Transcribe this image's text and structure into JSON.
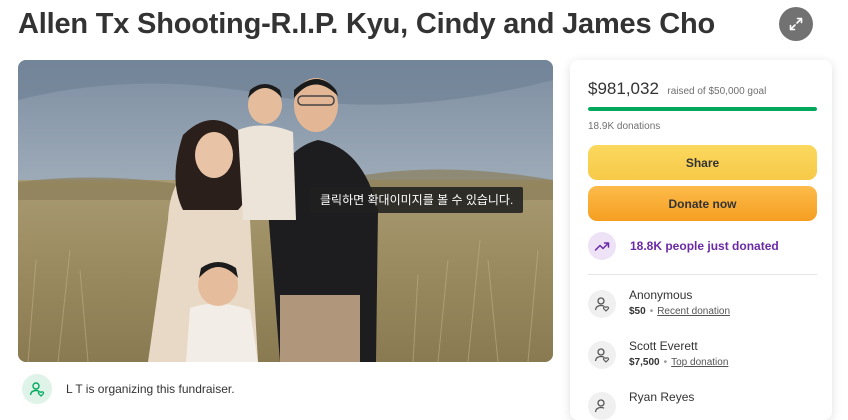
{
  "page": {
    "title": "Allen Tx Shooting-R.I.P. Kyu, Cindy and James Cho"
  },
  "hero": {
    "tooltip": "클릭하면 확대이미지를 볼 수 있습니다."
  },
  "organizer": {
    "text": "L T is organizing this fundraiser."
  },
  "donation_card": {
    "raised_amount": "$981,032",
    "goal_text": "raised of $50,000 goal",
    "progress_fraction": 1.0,
    "donation_count": "18.9K donations",
    "share_label": "Share",
    "donate_label": "Donate now",
    "recent_activity": "18.8K people just donated",
    "donors": [
      {
        "name": "Anonymous",
        "amount": "$50",
        "tag": "Recent donation"
      },
      {
        "name": "Scott Everett",
        "amount": "$7,500",
        "tag": "Top donation"
      },
      {
        "name": "Ryan Reyes",
        "amount": "",
        "tag": ""
      }
    ]
  },
  "colors": {
    "progress_green": "#02a95c",
    "share_yellow": "#f7c948",
    "donate_orange": "#f59f22",
    "trend_purple": "#6b2aa5"
  },
  "icons": {
    "expand": "expand-arrows-icon",
    "organizer": "user-heart-icon",
    "trend": "trending-up-icon",
    "donor": "user-heart-icon"
  }
}
